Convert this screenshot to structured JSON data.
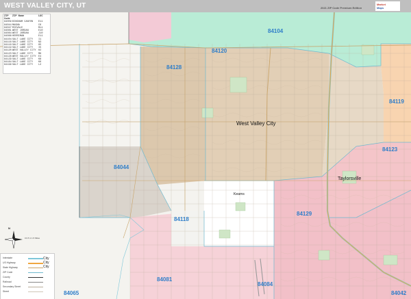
{
  "header": {
    "title": "WEST VALLEY CITY, UT",
    "edition": "2021 ZIP Code Premium Edition",
    "logo_text": "Market Maps"
  },
  "zip_table": {
    "columns": [
      "ZIP Code",
      "ZIP Name",
      "LOC"
    ],
    "rows": [
      [
        "84009",
        "BINGHAM CANYON",
        "E11"
      ],
      [
        "84044",
        "MAGNA",
        "C6"
      ],
      [
        "84047",
        "MIDVALE",
        "M11"
      ],
      [
        "84081",
        "WEST JORDAN",
        "E10"
      ],
      [
        "84084",
        "WEST JORDAN",
        "J10"
      ],
      [
        "84088",
        "HERRIMAN",
        "E11"
      ],
      [
        "84104",
        "SALT LAKE CITY",
        "I1"
      ],
      [
        "84116",
        "SALT LAKE CITY",
        "N3"
      ],
      [
        "84118",
        "SALT LAKE CITY",
        "H5"
      ],
      [
        "84119",
        "SALT LAKE CITY",
        "I5"
      ],
      [
        "84120",
        "WEST VALLEY CITY",
        "H2"
      ],
      [
        "84123",
        "SALT LAKE CITY",
        "M8"
      ],
      [
        "84128",
        "WEST VALLEY CITY",
        "E4"
      ],
      [
        "84129",
        "SALT LAKE CITY",
        "K8"
      ],
      [
        "84184",
        "SALT LAKE CITY",
        "K6"
      ],
      [
        "84199",
        "SALT LAKE CITY",
        "L2"
      ]
    ]
  },
  "map": {
    "zip_labels": [
      "84104",
      "84120",
      "84128",
      "84044",
      "84118",
      "84119",
      "84123",
      "84129",
      "84081",
      "84084",
      "84065",
      "84042"
    ],
    "city_labels": [
      "West Valley City",
      "Taylorsville",
      "Kearns"
    ],
    "colors": {
      "zip_84104": "#b9ecd6",
      "zip_84120": "#e2cfb6",
      "zip_84128": "#d9c9b1",
      "zip_84119": "#d8c6ae",
      "zip_84123": "#f3c5c5",
      "zip_84129": "#f2c0c8",
      "zip_84118": "#ffffff",
      "zip_84117": "#f8d4b0",
      "zip_84081": "#f6d2d8",
      "zip_84044": "#dad4cc",
      "zip_label_color": "#2f7ec9",
      "highway": "#f0a640",
      "major_road": "#c9a46a",
      "zip_border": "#7ec7d9"
    }
  },
  "map_legend": {
    "items": [
      "Interstate",
      "US Highway",
      "State Highway",
      "ZIP Code",
      "County",
      "Railroad",
      "Secondary Street",
      "Street"
    ],
    "city_text": [
      "City",
      "City",
      "City"
    ]
  },
  "compass": {
    "north": "N"
  },
  "scale": {
    "text": "0 0.5 1 1.5 Miles"
  }
}
